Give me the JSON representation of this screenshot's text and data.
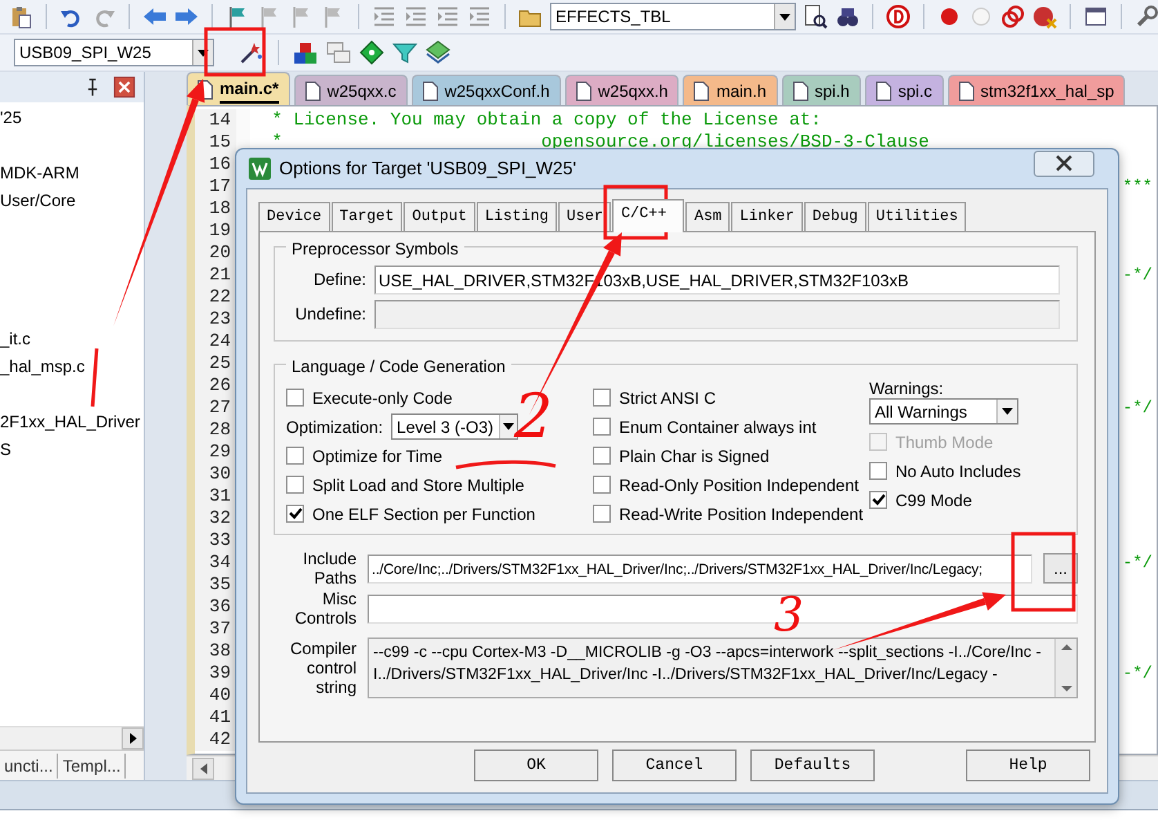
{
  "toolbar": {
    "find_combo": {
      "value": "EFFECTS_TBL"
    },
    "target_combo": {
      "value": "USB09_SPI_W25"
    }
  },
  "project_panel": {
    "items": [
      {
        "label": "'25"
      },
      {
        "label": "MDK-ARM"
      },
      {
        "label": "User/Core"
      },
      {
        "label": "_it.c"
      },
      {
        "label": "_hal_msp.c"
      },
      {
        "label": "2F1xx_HAL_Driver"
      },
      {
        "label": "S"
      }
    ],
    "tabs": [
      {
        "label": "uncti..."
      },
      {
        "label": "Templ..."
      }
    ]
  },
  "editor": {
    "tabs": [
      {
        "label": "main.c*",
        "selected": true,
        "color": "#f3dfa6"
      },
      {
        "label": "w25qxx.c",
        "selected": false,
        "color": "#c8b4cc"
      },
      {
        "label": "w25qxxConf.h",
        "selected": false,
        "color": "#a8c8dc"
      },
      {
        "label": "w25qxx.h",
        "selected": false,
        "color": "#dcacc4"
      },
      {
        "label": "main.h",
        "selected": false,
        "color": "#f4b98a"
      },
      {
        "label": "spi.h",
        "selected": false,
        "color": "#a8ccbe"
      },
      {
        "label": "spi.c",
        "selected": false,
        "color": "#c4b2e0"
      },
      {
        "label": "stm32f1xx_hal_sp",
        "selected": false,
        "color": "#f09c9c"
      }
    ],
    "lines": [
      {
        "number": "14",
        "text": "  * License. You may obtain a copy of the License at:"
      },
      {
        "number": "15",
        "text": "  *                        opensource.org/licenses/BSD-3-Clause"
      },
      {
        "number": "16"
      },
      {
        "number": "17",
        "tail": "***"
      },
      {
        "number": "18"
      },
      {
        "number": "19"
      },
      {
        "number": "20"
      },
      {
        "number": "21",
        "tail": "-*/"
      },
      {
        "number": "22"
      },
      {
        "number": "23"
      },
      {
        "number": "24"
      },
      {
        "number": "25"
      },
      {
        "number": "26"
      },
      {
        "number": "27",
        "tail": "-*/"
      },
      {
        "number": "28"
      },
      {
        "number": "29"
      },
      {
        "number": "30"
      },
      {
        "number": "31"
      },
      {
        "number": "32"
      },
      {
        "number": "33"
      },
      {
        "number": "34",
        "tail": "-*/"
      },
      {
        "number": "35"
      },
      {
        "number": "36"
      },
      {
        "number": "37"
      },
      {
        "number": "38"
      },
      {
        "number": "39",
        "tail": "-*/"
      },
      {
        "number": "40"
      },
      {
        "number": "41"
      },
      {
        "number": "42"
      }
    ]
  },
  "dialog": {
    "title": "Options for Target 'USB09_SPI_W25'",
    "tabs": [
      {
        "label": "Device",
        "selected": false
      },
      {
        "label": "Target",
        "selected": false
      },
      {
        "label": "Output",
        "selected": false
      },
      {
        "label": "Listing",
        "selected": false
      },
      {
        "label": "User",
        "selected": false
      },
      {
        "label": "C/C++",
        "selected": true
      },
      {
        "label": "Asm",
        "selected": false
      },
      {
        "label": "Linker",
        "selected": false
      },
      {
        "label": "Debug",
        "selected": false
      },
      {
        "label": "Utilities",
        "selected": false
      }
    ],
    "preprocessor": {
      "title": "Preprocessor Symbols",
      "define": {
        "label": "Define:",
        "value": "USE_HAL_DRIVER,STM32F103xB,USE_HAL_DRIVER,STM32F103xB"
      },
      "undefine": {
        "label": "Undefine:"
      }
    },
    "language": {
      "title": "Language / Code Generation",
      "columns": [
        [
          {
            "kind": "checkbox",
            "label": "Execute-only Code",
            "checked": false,
            "disabled": false
          },
          {
            "kind": "select",
            "label": "Optimization:",
            "value": "Level 3 (-O3)"
          },
          {
            "kind": "checkbox",
            "label": "Optimize for Time",
            "checked": false,
            "disabled": false
          },
          {
            "kind": "checkbox",
            "label": "Split Load and Store Multiple",
            "checked": false,
            "disabled": false
          },
          {
            "kind": "checkbox",
            "label": "One ELF Section per Function",
            "checked": true,
            "disabled": false
          }
        ],
        [
          {
            "kind": "checkbox",
            "label": "Strict ANSI C",
            "checked": false,
            "disabled": false
          },
          {
            "kind": "checkbox",
            "label": "Enum Container always int",
            "checked": false,
            "disabled": false
          },
          {
            "kind": "checkbox",
            "label": "Plain Char is Signed",
            "checked": false,
            "disabled": false
          },
          {
            "kind": "checkbox",
            "label": "Read-Only Position Independent",
            "checked": false,
            "disabled": false
          },
          {
            "kind": "checkbox",
            "label": "Read-Write Position Independent",
            "checked": false,
            "disabled": false
          }
        ],
        [
          {
            "kind": "stacked-select",
            "label": "Warnings:",
            "value": "All Warnings"
          },
          {
            "kind": "checkbox",
            "label": "Thumb Mode",
            "checked": false,
            "disabled": true
          },
          {
            "kind": "checkbox",
            "label": "No Auto Includes",
            "checked": false,
            "disabled": false
          },
          {
            "kind": "checkbox",
            "label": "C99 Mode",
            "checked": true,
            "disabled": false
          }
        ]
      ]
    },
    "include_paths": {
      "label": "Include Paths",
      "value": "../Core/Inc;../Drivers/STM32F1xx_HAL_Driver/Inc;../Drivers/STM32F1xx_HAL_Driver/Inc/Legacy;",
      "browse": "..."
    },
    "misc_controls": {
      "label": "Misc Controls"
    },
    "compiler_string": {
      "label": "Compiler control string",
      "lines": [
        "--c99 -c --cpu Cortex-M3 -D__MICROLIB -g -O3 --apcs=interwork --split_sections -I../Core/Inc -",
        "I../Drivers/STM32F1xx_HAL_Driver/Inc -I../Drivers/STM32F1xx_HAL_Driver/Inc/Legacy -"
      ]
    },
    "buttons": [
      {
        "label": "OK"
      },
      {
        "label": "Cancel"
      },
      {
        "label": "Defaults"
      },
      {
        "label": "Help"
      }
    ]
  },
  "annotations": {
    "numbers": [
      "2",
      "3"
    ]
  }
}
